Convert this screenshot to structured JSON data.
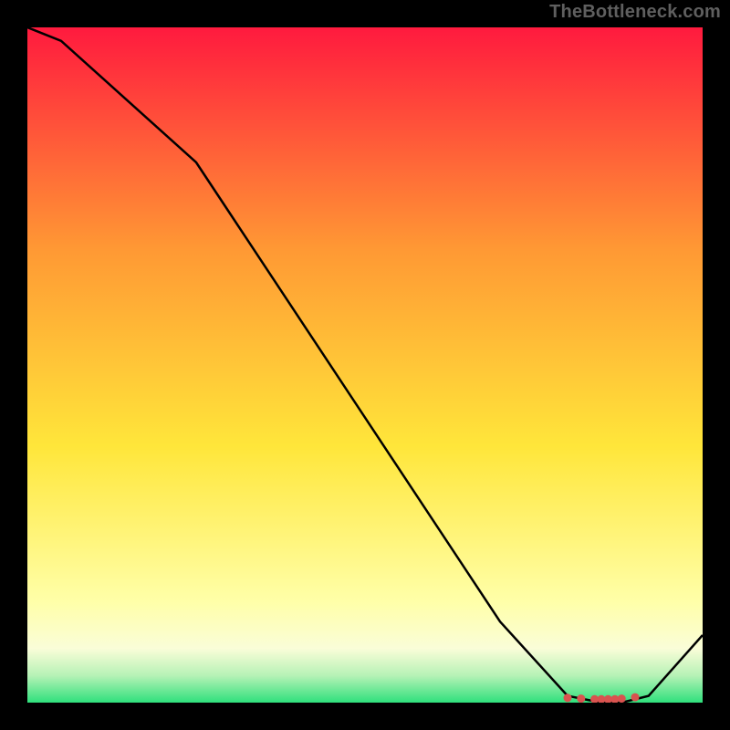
{
  "watermark": "TheBottleneck.com",
  "colors": {
    "top_red": "#ff1a3e",
    "mid_orange": "#ff9934",
    "yellow": "#ffe63a",
    "pale_yellow": "#ffffa8",
    "cream": "#fafdd8",
    "mint": "#b6f2b6",
    "green": "#2fe07c",
    "line": "#000000",
    "marker": "#d9534f",
    "bg": "#000000"
  },
  "chart_data": {
    "type": "line",
    "title": "",
    "xlabel": "",
    "ylabel": "",
    "xlim": [
      0,
      100
    ],
    "ylim": [
      0,
      100
    ],
    "series": [
      {
        "name": "bottleneck-curve",
        "x": [
          0,
          5,
          25,
          70,
          80,
          85,
          88,
          92,
          100
        ],
        "values": [
          100,
          98,
          80,
          12,
          1,
          0,
          0,
          1,
          10
        ]
      }
    ],
    "markers": {
      "name": "optimal-range",
      "x": [
        80,
        82,
        84,
        85,
        86,
        87,
        88,
        90
      ],
      "values": [
        0.7,
        0.6,
        0.5,
        0.5,
        0.5,
        0.5,
        0.6,
        0.8
      ]
    },
    "gradient_bands": [
      {
        "pos": 0.0,
        "color": "#ff1a3e"
      },
      {
        "pos": 0.33,
        "color": "#ff9934"
      },
      {
        "pos": 0.62,
        "color": "#ffe63a"
      },
      {
        "pos": 0.85,
        "color": "#ffffa8"
      },
      {
        "pos": 0.92,
        "color": "#fafdd8"
      },
      {
        "pos": 0.96,
        "color": "#b6f2b6"
      },
      {
        "pos": 1.0,
        "color": "#2fe07c"
      }
    ]
  }
}
